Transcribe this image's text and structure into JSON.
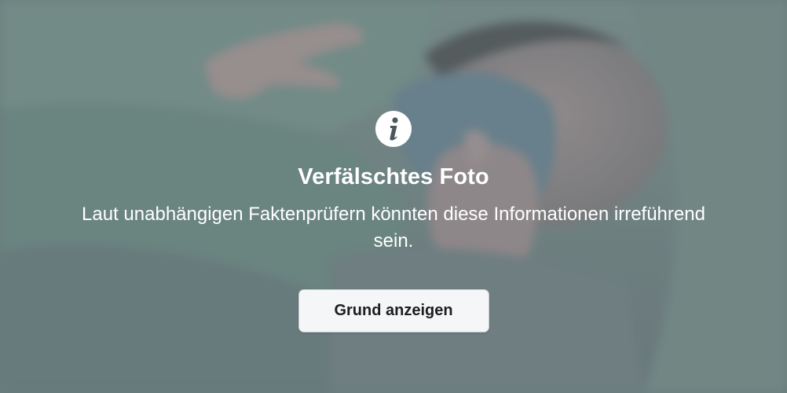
{
  "overlay": {
    "icon": "info-icon",
    "title": "Verfälschtes Foto",
    "message": "Laut unabhängigen Faktenprüfern könnten diese Informationen irreführend sein.",
    "button_label": "Grund anzeigen"
  },
  "colors": {
    "text": "#ffffff",
    "button_background": "#f5f6f7",
    "button_text": "#1c1e21",
    "backdrop_tint": "#7f9393"
  }
}
